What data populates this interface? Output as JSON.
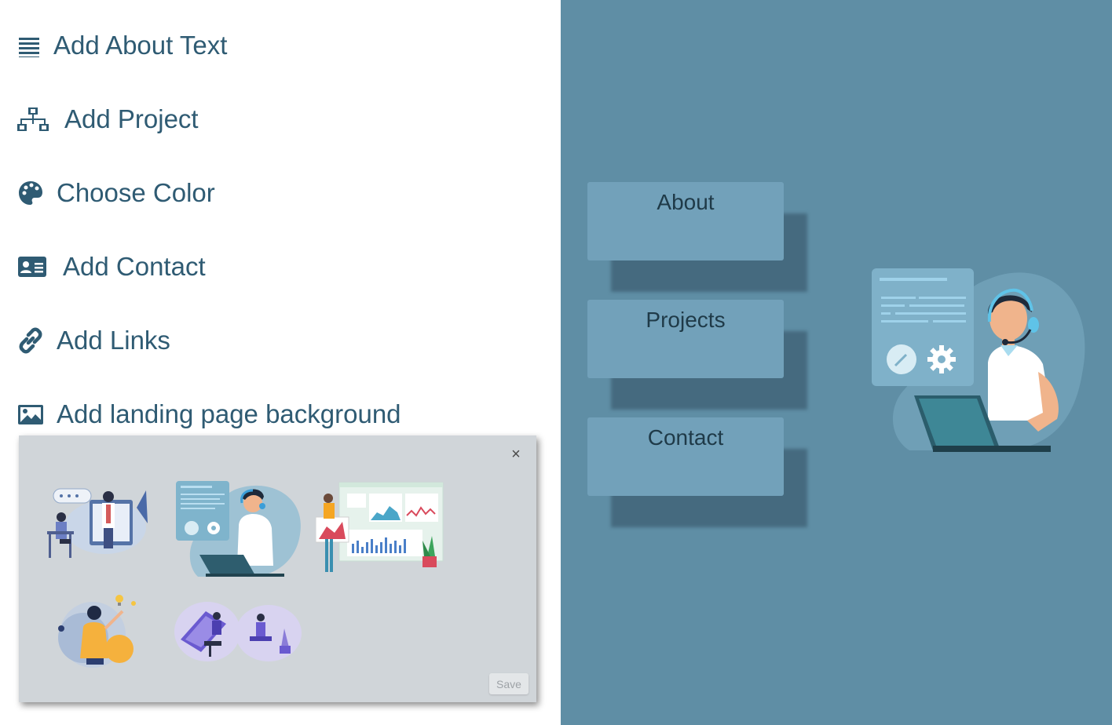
{
  "sidebar": {
    "items": [
      {
        "label": "Add About Text",
        "icon": "align-justify-icon"
      },
      {
        "label": "Add Project",
        "icon": "sitemap-icon"
      },
      {
        "label": "Choose Color",
        "icon": "palette-icon"
      },
      {
        "label": "Add Contact",
        "icon": "address-card-icon"
      },
      {
        "label": "Add Links",
        "icon": "link-icon"
      },
      {
        "label": "Add landing page background",
        "icon": "image-icon"
      }
    ]
  },
  "background_picker": {
    "close_icon": "close-icon",
    "close_label": "×",
    "save_label": "Save",
    "thumbnails": [
      "teacher-illustration",
      "support-agent-illustration",
      "analytics-dashboard-illustration",
      "idea-woman-illustration",
      "designers-illustration"
    ]
  },
  "preview": {
    "nav": [
      {
        "label": "About"
      },
      {
        "label": "Projects"
      },
      {
        "label": "Contact"
      }
    ],
    "hero_image": "support-agent-illustration"
  },
  "colors": {
    "text": "#2f5b73",
    "panel": "#5f8ea5",
    "button": "#72a1ba",
    "modal": "#d0d5d9"
  }
}
